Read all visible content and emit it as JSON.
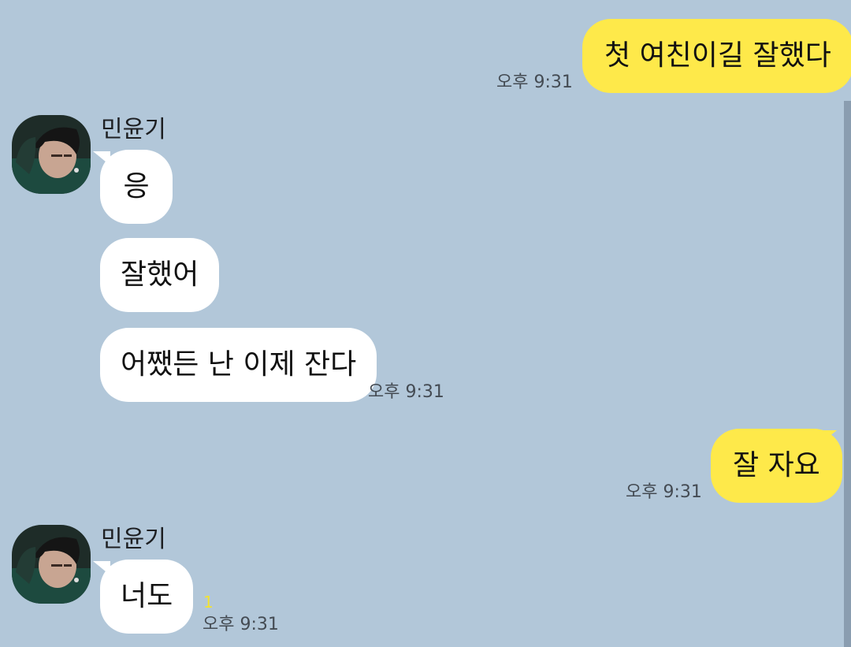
{
  "colors": {
    "background": "#b2c7d9",
    "my_bubble": "#fee94a",
    "their_bubble": "#ffffff",
    "unread": "#f3e230"
  },
  "messages": {
    "m1": {
      "text": "첫 여친이길 잘했다",
      "time": "오후 9:31"
    },
    "sender1": {
      "name": "민윤기"
    },
    "m2": {
      "text": "응"
    },
    "m3": {
      "text": "잘했어"
    },
    "m4": {
      "text": "어쨌든 난 이제 잔다",
      "time": "오후 9:31"
    },
    "m5": {
      "text": "잘 자요",
      "time": "오후 9:31"
    },
    "sender2": {
      "name": "민윤기"
    },
    "m6": {
      "text": "너도",
      "unread": "1",
      "time": "오후 9:31"
    }
  },
  "avatar_icon": "profile-photo-icon"
}
